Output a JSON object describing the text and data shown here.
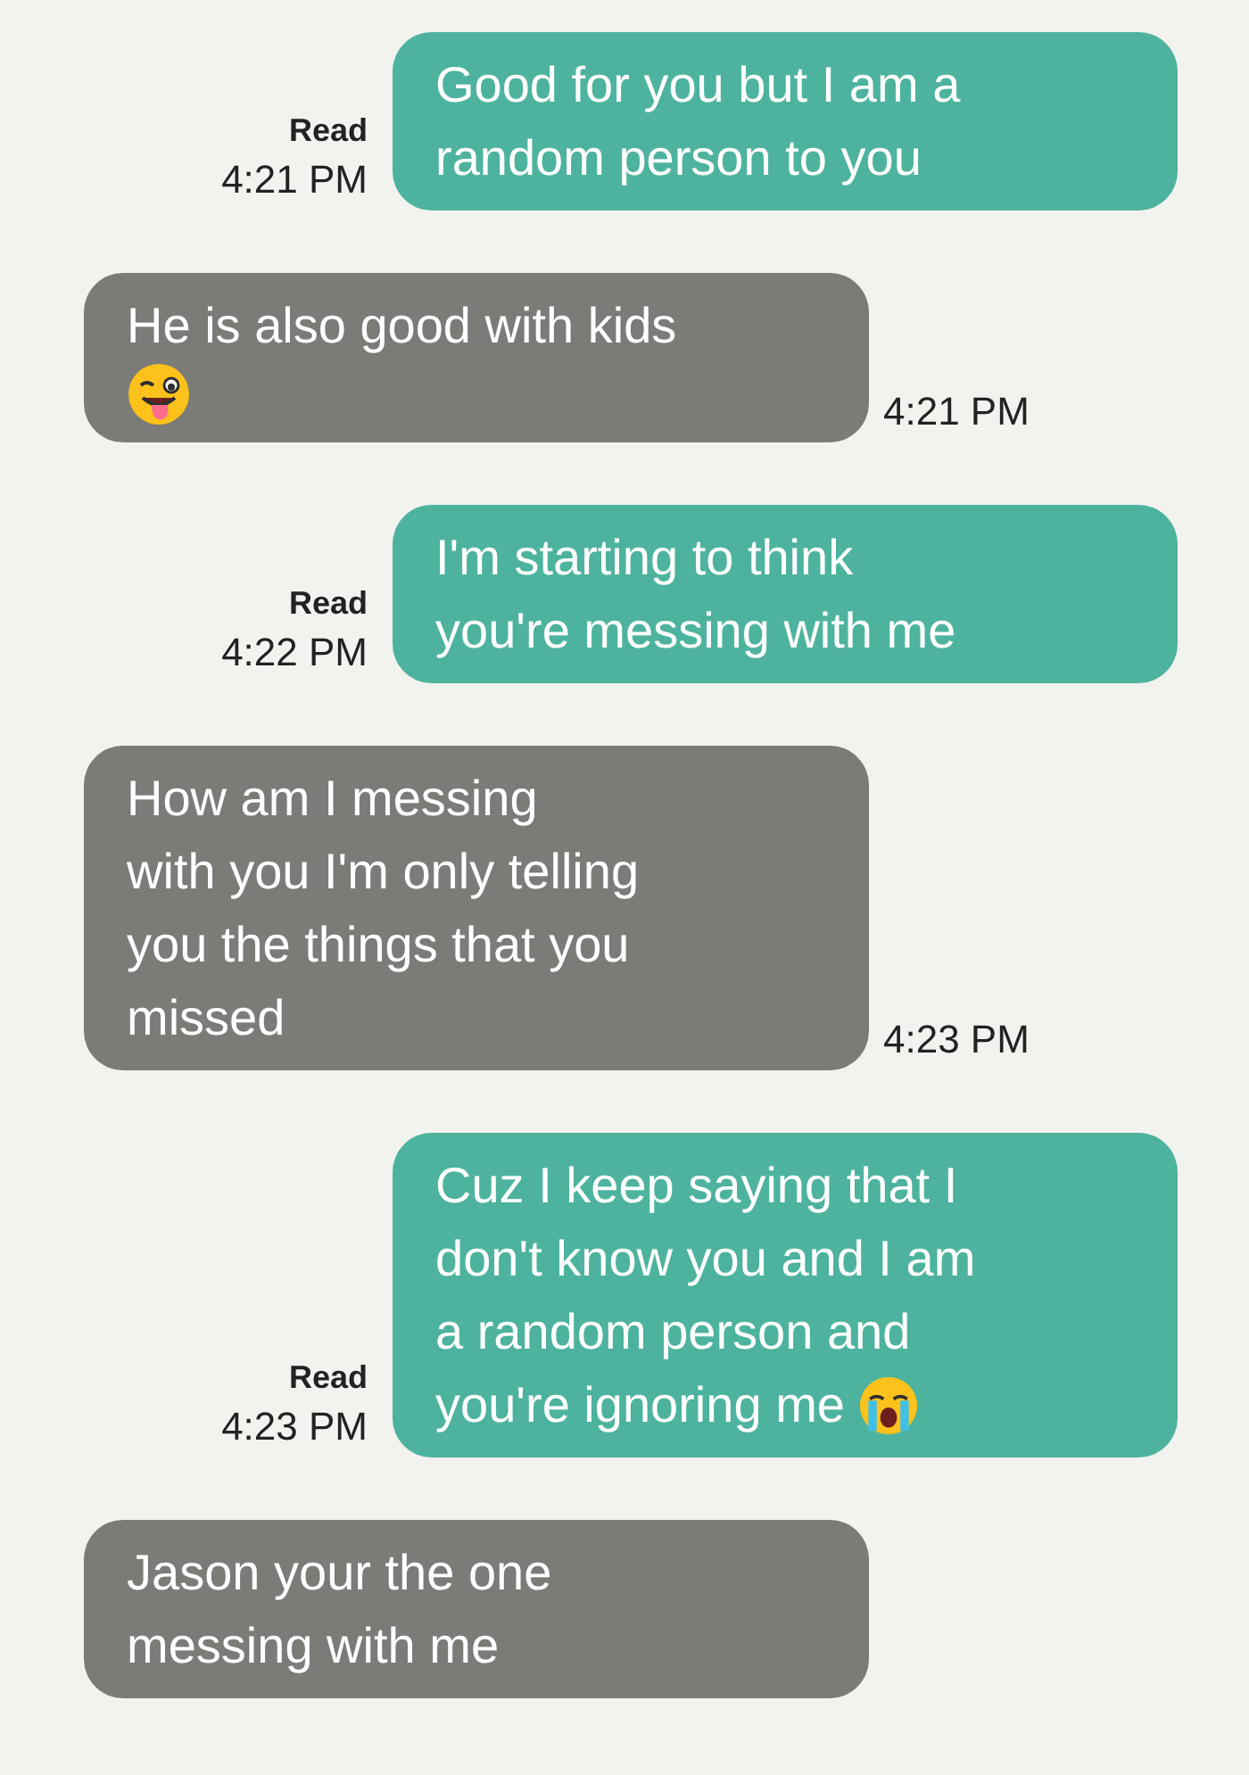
{
  "messages": [
    {
      "kind": "sent",
      "lines": [
        "Good for you but I am a",
        "random person to you"
      ],
      "status": "Read",
      "time": "4:21 PM"
    },
    {
      "kind": "received",
      "lines": [
        "He is also good with kids"
      ],
      "emoji": {
        "kind": "tongue"
      },
      "time": "4:21 PM"
    },
    {
      "kind": "sent",
      "lines": [
        "I'm starting to think",
        "you're messing with me"
      ],
      "status": "Read",
      "time": "4:22 PM"
    },
    {
      "kind": "received",
      "lines": [
        "How am I messing",
        "with you I'm only telling",
        "you the things that you",
        "missed"
      ],
      "time": "4:23 PM"
    },
    {
      "kind": "sent",
      "lines": [
        "Cuz I keep saying that I",
        "don't know you and I am",
        "a random person and",
        "you're ignoring me"
      ],
      "emoji": {
        "kind": "crying"
      },
      "status": "Read",
      "time": "4:23 PM"
    },
    {
      "kind": "received",
      "lines": [
        "Jason your the one",
        "messing with me"
      ]
    }
  ]
}
